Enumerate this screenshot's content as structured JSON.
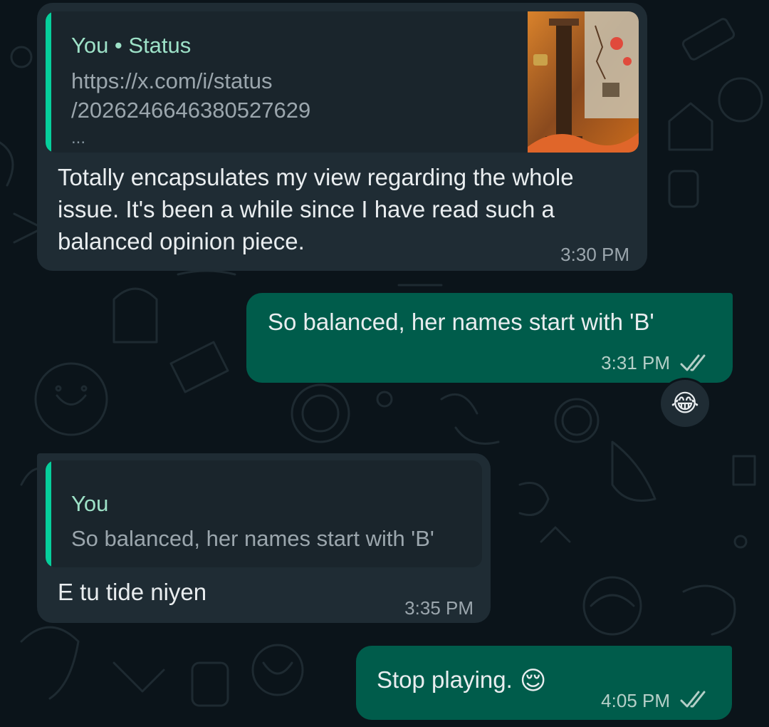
{
  "messages": [
    {
      "direction": "incoming",
      "quote": {
        "author": "You • Status",
        "link_line1": "https://x.com/i/status",
        "link_line2": "/2026246646380527629",
        "ellipsis": "..."
      },
      "text": "Totally encapsulates my view regarding the whole issue. It's been a while since I have read such a balanced opinion piece.",
      "time": "3:30 PM"
    },
    {
      "direction": "outgoing",
      "text": "So balanced, her names start with 'B'",
      "time": "3:31 PM",
      "status": "read",
      "reaction": "😂"
    },
    {
      "direction": "incoming",
      "quote": {
        "author": "You",
        "text": "So balanced, her names start with 'B'"
      },
      "text": "E tu tide niyen",
      "time": "3:35 PM"
    },
    {
      "direction": "outgoing",
      "text": "Stop playing.",
      "emoji": "😌",
      "time": "4:05 PM",
      "status": "read"
    }
  ],
  "colors": {
    "background": "#0b141a",
    "incoming_bubble": "#1f2c34",
    "outgoing_bubble": "#005c4b",
    "quote_bar": "#06cf9c",
    "read_ticks": "#9ba6ad"
  },
  "icons": {
    "read_status": "double-check-icon",
    "status_thumbnail": "status-thumbnail-image"
  }
}
